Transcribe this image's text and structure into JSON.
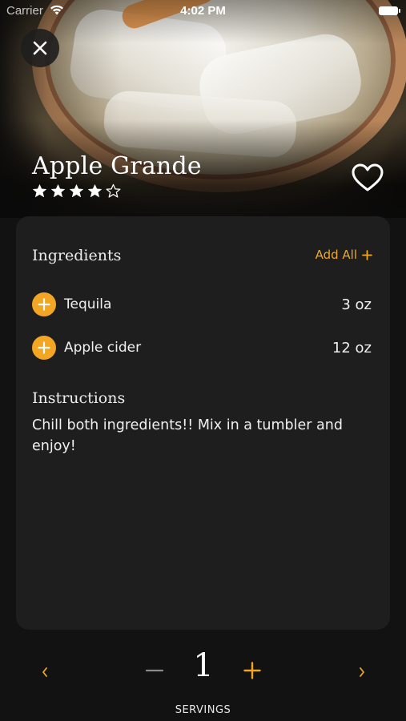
{
  "status_bar": {
    "carrier": "Carrier",
    "time": "4:02 PM"
  },
  "recipe": {
    "title": "Apple Grande",
    "rating": 4,
    "rating_max": 5,
    "favorite": false
  },
  "ingredients": {
    "heading": "Ingredients",
    "add_all_label": "Add All",
    "items": [
      {
        "name": "Tequila",
        "amount": "3 oz"
      },
      {
        "name": "Apple cider",
        "amount": "12 oz"
      }
    ]
  },
  "instructions": {
    "heading": "Instructions",
    "text": "Chill both ingredients!! Mix in a tumbler and enjoy!"
  },
  "servings": {
    "count": "1",
    "label": "SERVINGS"
  },
  "colors": {
    "accent": "#f2a623",
    "background": "#121212",
    "card": "#1e1e1e",
    "disabled": "#8a8a8a"
  },
  "icons": {
    "close": "close-icon",
    "favorite": "heart-outline-icon",
    "star_filled": "star-filled-icon",
    "star_empty": "star-outline-icon",
    "add": "plus-icon",
    "prev": "chevron-left-icon",
    "next": "chevron-right-icon",
    "decrement": "minus-icon",
    "increment": "plus-icon"
  }
}
